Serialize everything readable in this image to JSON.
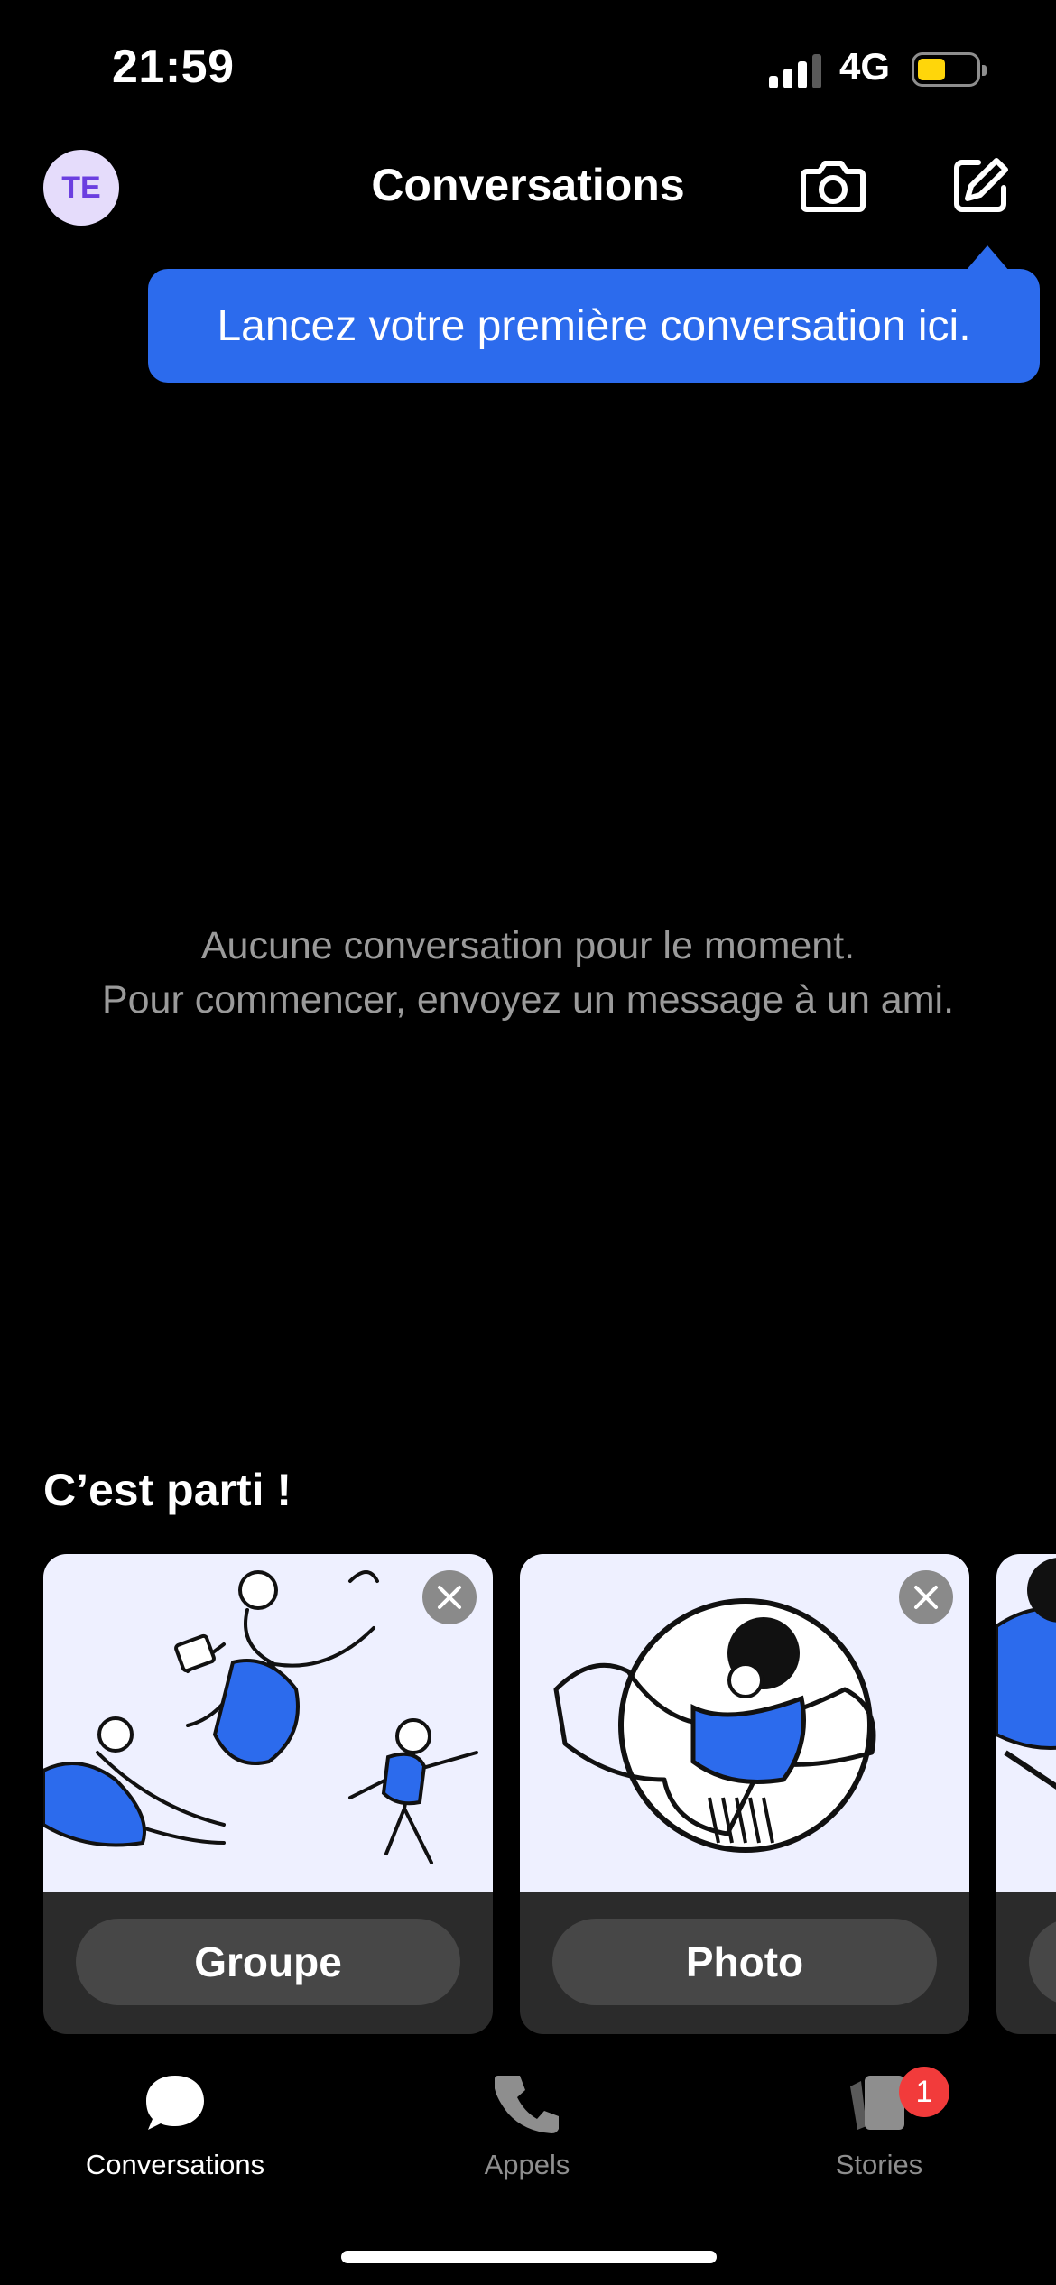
{
  "status_bar": {
    "time": "21:59",
    "network": "4G",
    "battery_level": 0.35,
    "battery_color": "#ffd60a"
  },
  "header": {
    "avatar_initials": "TE",
    "title": "Conversations",
    "camera_icon": "camera-icon",
    "compose_icon": "compose-icon"
  },
  "tooltip": {
    "text": "Lancez votre première conversation ici.",
    "color": "#2c6bed"
  },
  "empty_state": {
    "line1": "Aucune conversation pour le moment.",
    "line2": "Pour commencer, envoyez un message à un ami."
  },
  "getting_started": {
    "title": "C’est parti !",
    "cards": [
      {
        "label": "Groupe",
        "illustration": "people-jumping-illustration"
      },
      {
        "label": "Photo",
        "illustration": "person-in-circle-illustration"
      }
    ]
  },
  "tab_bar": {
    "tabs": [
      {
        "label": "Conversations",
        "icon": "chat-bubble-icon",
        "active": true
      },
      {
        "label": "Appels",
        "icon": "phone-icon",
        "active": false
      },
      {
        "label": "Stories",
        "icon": "stories-icon",
        "active": false,
        "badge": "1"
      }
    ]
  }
}
